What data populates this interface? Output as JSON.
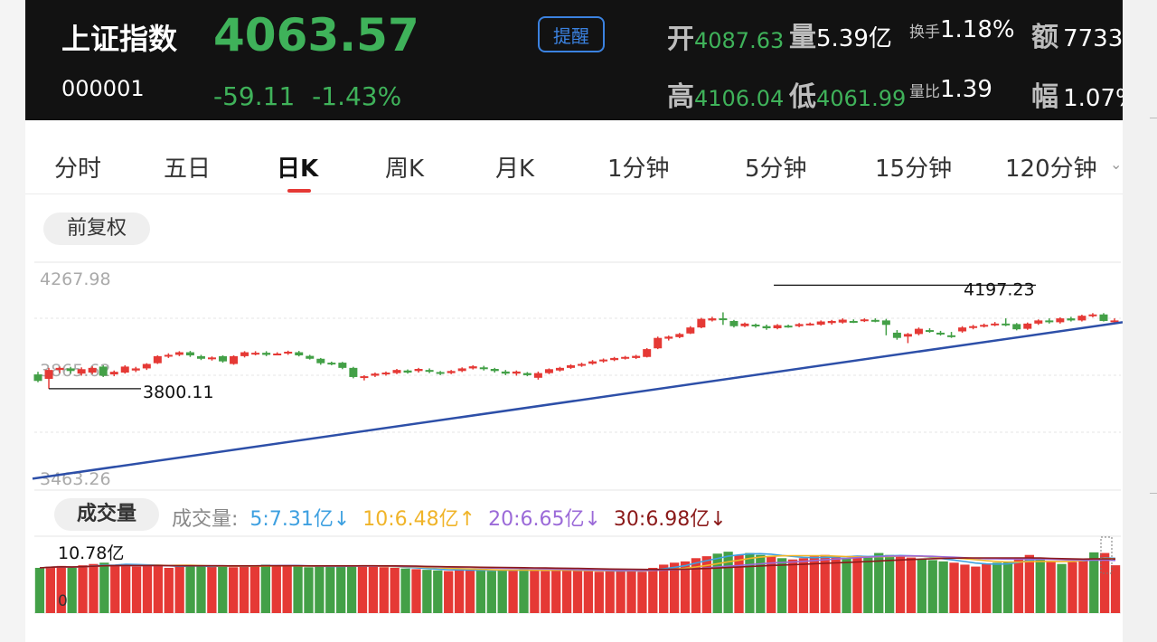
{
  "header": {
    "name": "上证指数",
    "code": "000001",
    "price": "4063.57",
    "change": "-59.11",
    "change_pct": "-1.43%",
    "remind_label": "提醒",
    "open_label": "开",
    "open_value": "4087.63",
    "volume_label": "量",
    "volume_value": "5.39亿",
    "turnover_label": "换手",
    "turnover_value": "1.18%",
    "amount_label": "额",
    "amount_value": "7733",
    "high_label": "高",
    "high_value": "4106.04",
    "low_label": "低",
    "low_value": "4061.99",
    "volratio_label": "量比",
    "volratio_value": "1.39",
    "amp_label": "幅",
    "amp_value": "1.07%"
  },
  "tabs": [
    "分时",
    "五日",
    "日K",
    "周K",
    "月K",
    "1分钟",
    "5分钟",
    "15分钟",
    "120分钟"
  ],
  "active_tab": "日K",
  "adjust_label": "前复权",
  "volume_section": {
    "pill_label": "成交量",
    "legend_title": "成交量:",
    "ma": [
      {
        "label": "5:7.31亿",
        "arrow": "↓",
        "color": "#3ea0e0"
      },
      {
        "label": "10:6.48亿",
        "arrow": "↑",
        "color": "#f0b429"
      },
      {
        "label": "20:6.65亿",
        "arrow": "↓",
        "color": "#9b6ad8"
      },
      {
        "label": "30:6.98亿",
        "arrow": "↓",
        "color": "#8b1a1a"
      }
    ],
    "max_label": "10.78亿",
    "zero_label": "0"
  },
  "colors": {
    "up": "#e53935",
    "down": "#43a047",
    "trendline": "#2d4fa8",
    "header_bg": "#121212",
    "price_green": "#3fb25a",
    "accent_blue": "#3b82e0"
  },
  "chart_data": {
    "type": "candlestick",
    "ylim": [
      3463.26,
      4267.98
    ],
    "y_labels": [
      "4267.98",
      "3865.62",
      "3463.26"
    ],
    "annotations": [
      {
        "text": "4197.23",
        "index": 68,
        "value": 4197.23
      },
      {
        "text": "3800.11",
        "index": 1,
        "value": 3800.11
      }
    ],
    "trendline": {
      "start_value": 3455,
      "end_value": 4055
    },
    "candles": [
      [
        3855,
        3830,
        3865,
        3825
      ],
      [
        3838,
        3872,
        3880,
        3800
      ],
      [
        3872,
        3880,
        3885,
        3860
      ],
      [
        3878,
        3868,
        3884,
        3858
      ],
      [
        3858,
        3875,
        3882,
        3850
      ],
      [
        3862,
        3880,
        3886,
        3856
      ],
      [
        3885,
        3850,
        3890,
        3845
      ],
      [
        3855,
        3865,
        3870,
        3848
      ],
      [
        3862,
        3885,
        3890,
        3858
      ],
      [
        3870,
        3878,
        3884,
        3864
      ],
      [
        3878,
        3895,
        3898,
        3872
      ],
      [
        3898,
        3925,
        3928,
        3895
      ],
      [
        3925,
        3930,
        3936,
        3918
      ],
      [
        3930,
        3940,
        3944,
        3925
      ],
      [
        3940,
        3928,
        3945,
        3922
      ],
      [
        3925,
        3915,
        3930,
        3910
      ],
      [
        3915,
        3920,
        3924,
        3908
      ],
      [
        3925,
        3905,
        3928,
        3900
      ],
      [
        3895,
        3925,
        3928,
        3892
      ],
      [
        3925,
        3940,
        3944,
        3920
      ],
      [
        3932,
        3938,
        3944,
        3928
      ],
      [
        3938,
        3930,
        3944,
        3925
      ],
      [
        3932,
        3935,
        3940,
        3928
      ],
      [
        3935,
        3942,
        3946,
        3930
      ],
      [
        3940,
        3928,
        3945,
        3924
      ],
      [
        3926,
        3915,
        3930,
        3912
      ],
      [
        3915,
        3898,
        3918,
        3892
      ],
      [
        3900,
        3895,
        3904,
        3890
      ],
      [
        3900,
        3880,
        3903,
        3875
      ],
      [
        3880,
        3845,
        3884,
        3840
      ],
      [
        3842,
        3848,
        3852,
        3832
      ],
      [
        3850,
        3858,
        3862,
        3845
      ],
      [
        3856,
        3862,
        3866,
        3850
      ],
      [
        3860,
        3872,
        3876,
        3856
      ],
      [
        3870,
        3862,
        3874,
        3858
      ],
      [
        3868,
        3876,
        3880,
        3862
      ],
      [
        3872,
        3865,
        3878,
        3860
      ],
      [
        3864,
        3858,
        3868,
        3852
      ],
      [
        3860,
        3868,
        3872,
        3856
      ],
      [
        3868,
        3878,
        3882,
        3864
      ],
      [
        3878,
        3886,
        3890,
        3874
      ],
      [
        3882,
        3876,
        3888,
        3870
      ],
      [
        3876,
        3868,
        3880,
        3862
      ],
      [
        3866,
        3858,
        3872,
        3852
      ],
      [
        3858,
        3866,
        3870,
        3850
      ],
      [
        3860,
        3852,
        3864,
        3848
      ],
      [
        3842,
        3860,
        3866,
        3835
      ],
      [
        3860,
        3875,
        3878,
        3856
      ],
      [
        3870,
        3880,
        3884,
        3866
      ],
      [
        3880,
        3890,
        3894,
        3876
      ],
      [
        3888,
        3895,
        3900,
        3884
      ],
      [
        3896,
        3905,
        3910,
        3892
      ],
      [
        3905,
        3912,
        3916,
        3900
      ],
      [
        3910,
        3918,
        3922,
        3906
      ],
      [
        3915,
        3922,
        3926,
        3912
      ],
      [
        3918,
        3926,
        3930,
        3914
      ],
      [
        3922,
        3952,
        3956,
        3920
      ],
      [
        3955,
        3995,
        4000,
        3952
      ],
      [
        3992,
        4000,
        4004,
        3985
      ],
      [
        3998,
        4010,
        4014,
        3994
      ],
      [
        4012,
        4035,
        4040,
        4010
      ],
      [
        4035,
        4068,
        4072,
        4032
      ],
      [
        4062,
        4070,
        4076,
        4058
      ],
      [
        4070,
        4065,
        4093,
        4045
      ],
      [
        4060,
        4040,
        4064,
        4035
      ],
      [
        4040,
        4050,
        4054,
        4036
      ],
      [
        4046,
        4040,
        4050,
        4034
      ],
      [
        4040,
        4032,
        4046,
        4026
      ],
      [
        4032,
        4044,
        4048,
        4028
      ],
      [
        4042,
        4038,
        4046,
        4034
      ],
      [
        4040,
        4048,
        4052,
        4036
      ],
      [
        4046,
        4050,
        4054,
        4042
      ],
      [
        4046,
        4058,
        4062,
        4042
      ],
      [
        4052,
        4060,
        4064,
        4046
      ],
      [
        4054,
        4065,
        4070,
        4050
      ],
      [
        4060,
        4058,
        4066,
        4052
      ],
      [
        4062,
        4066,
        4070,
        4056
      ],
      [
        4064,
        4060,
        4070,
        4055
      ],
      [
        4062,
        4045,
        4068,
        4005
      ],
      [
        4015,
        3995,
        4025,
        3988
      ],
      [
        4000,
        4010,
        4014,
        3975
      ],
      [
        4010,
        4030,
        4035,
        4005
      ],
      [
        4025,
        4020,
        4032,
        4015
      ],
      [
        4015,
        4008,
        4022,
        4004
      ],
      [
        4005,
        4000,
        4018,
        3995
      ],
      [
        4020,
        4035,
        4040,
        4015
      ],
      [
        4035,
        4040,
        4045,
        4028
      ],
      [
        4040,
        4045,
        4050,
        4035
      ],
      [
        4045,
        4050,
        4056,
        4040
      ],
      [
        4050,
        4048,
        4070,
        4040
      ],
      [
        4048,
        4028,
        4052,
        4024
      ],
      [
        4030,
        4050,
        4054,
        4026
      ],
      [
        4050,
        4062,
        4066,
        4045
      ],
      [
        4062,
        4055,
        4070,
        4050
      ],
      [
        4055,
        4070,
        4074,
        4050
      ],
      [
        4070,
        4062,
        4076,
        4058
      ],
      [
        4062,
        4080,
        4084,
        4058
      ],
      [
        4078,
        4085,
        4090,
        4074
      ],
      [
        4085,
        4060,
        4090,
        4058
      ],
      [
        4062,
        4062,
        4070,
        4055
      ]
    ],
    "volume": {
      "ylim": [
        0,
        10.78
      ],
      "values": [
        7.0,
        7.2,
        7.3,
        7.0,
        7.4,
        7.6,
        7.8,
        7.4,
        7.6,
        7.2,
        7.3,
        7.5,
        7.0,
        7.2,
        7.4,
        7.3,
        7.2,
        7.3,
        7.1,
        7.3,
        7.4,
        7.5,
        7.4,
        7.3,
        7.2,
        7.1,
        7.3,
        7.2,
        7.3,
        7.4,
        7.3,
        7.2,
        7.1,
        7.0,
        6.9,
        6.8,
        6.7,
        6.6,
        6.5,
        6.8,
        6.7,
        6.6,
        6.5,
        6.6,
        6.7,
        6.8,
        6.6,
        6.5,
        6.6,
        6.7,
        6.6,
        6.5,
        6.4,
        6.5,
        6.6,
        6.7,
        6.4,
        7.0,
        7.5,
        7.8,
        8.0,
        8.5,
        8.8,
        9.2,
        9.5,
        9.0,
        9.3,
        9.0,
        8.8,
        8.5,
        8.3,
        8.5,
        8.8,
        9.0,
        8.8,
        8.5,
        8.9,
        8.6,
        9.3,
        9.0,
        8.8,
        8.6,
        8.4,
        8.2,
        8.0,
        7.8,
        7.5,
        7.2,
        7.6,
        7.8,
        8.0,
        8.5,
        9.0,
        8.5,
        8.0,
        7.6,
        7.9,
        8.4,
        9.4,
        9.3,
        7.4
      ],
      "ma_series": [
        {
          "name": "5",
          "color": "#3ea0e0",
          "start": 7.4,
          "values_note": "moving averages"
        },
        {
          "name": "10",
          "color": "#f0b429"
        },
        {
          "name": "20",
          "color": "#9b6ad8"
        },
        {
          "name": "30",
          "color": "#8b1a1a"
        }
      ]
    }
  }
}
